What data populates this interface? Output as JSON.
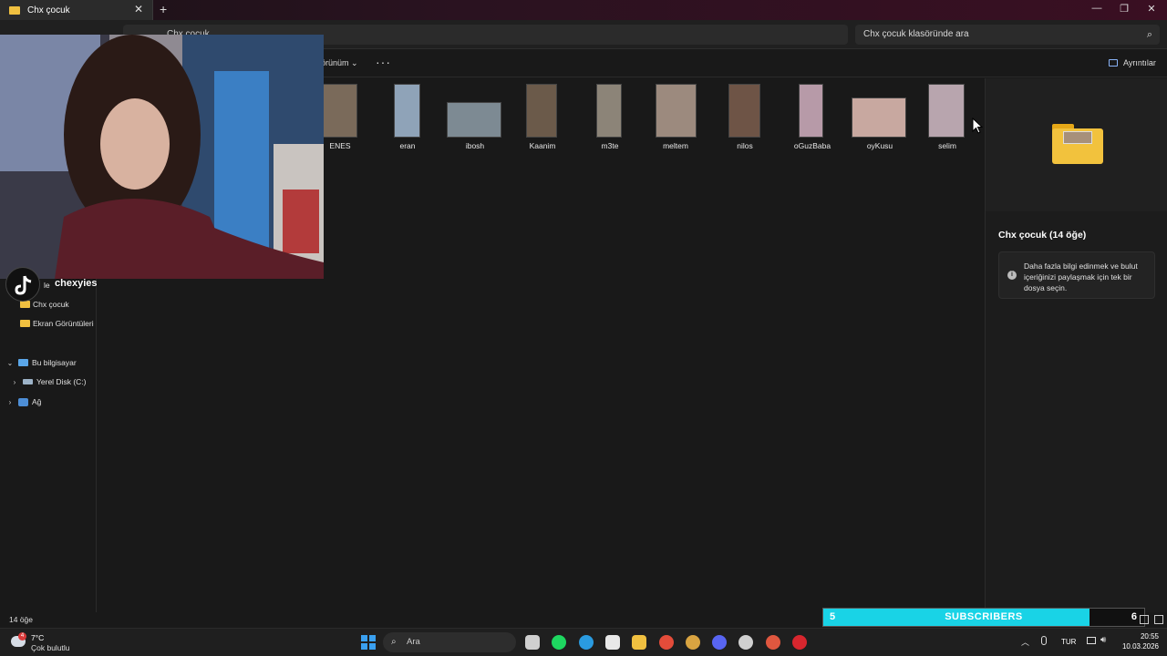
{
  "window": {
    "tab_title": "Chx çocuk",
    "tab_close": "✕",
    "new_tab": "+",
    "minimize": "—",
    "maximize": "❐",
    "close": "✕"
  },
  "addressbar": {
    "path": "Chx çocuk",
    "search_placeholder": "Chx çocuk klasöründe ara"
  },
  "commandbar": {
    "view_label": "örünüm",
    "more_label": "···",
    "details_label": "Ayrıntılar"
  },
  "nav": {
    "quick_partial": "le",
    "items": [
      {
        "label": "Chx çocuk",
        "icon": "folder-icon"
      },
      {
        "label": "Ekran Görüntüleri",
        "icon": "folder-icon"
      },
      {
        "label": "Bu bilgisayar",
        "icon": "pc-icon",
        "expanded": true
      },
      {
        "label": "Yerel Disk (C:)",
        "icon": "disk-icon",
        "expanded": false
      },
      {
        "label": "Ağ",
        "icon": "network-icon",
        "expanded": false
      }
    ]
  },
  "files": [
    {
      "name": "ENES",
      "thumb_color": "#7a6a5a"
    },
    {
      "name": "eran",
      "thumb_color": "#8fa3b8"
    },
    {
      "name": "ibosh",
      "thumb_color": "#7d8a93"
    },
    {
      "name": "Kaanim",
      "thumb_color": "#6b5a4a"
    },
    {
      "name": "m3te",
      "thumb_color": "#8c8478"
    },
    {
      "name": "meltem",
      "thumb_color": "#9c8a7e"
    },
    {
      "name": "nilos",
      "thumb_color": "#6e5446"
    },
    {
      "name": "oGuzBaba",
      "thumb_color": "#b79aa8"
    },
    {
      "name": "oyKusu",
      "thumb_color": "#c8a8a0"
    },
    {
      "name": "selim",
      "thumb_color": "#b8a5ae"
    }
  ],
  "details": {
    "folder_title": "Chx çocuk (14 öğe)",
    "info_text": "Daha fazla bilgi edinmek ve bulut içeriğinizi paylaşmak için tek bir dosya seçin.",
    "info_icon": "i"
  },
  "status": {
    "item_count": "14 öğe"
  },
  "overlay": {
    "tiktok_handle": "chexyies",
    "subscribers": {
      "current": "5",
      "label": "SUBSCRIBERS",
      "goal": "6",
      "progress": 0.83
    }
  },
  "taskbar": {
    "weather_temp": "7°C",
    "weather_condition": "Çok bulutlu",
    "weather_badge": "4",
    "search_placeholder": "Ara",
    "lang": "TUR",
    "time": "20:55",
    "date": "10.03.2026",
    "apps": [
      {
        "name": "task-view-icon",
        "color": "#cfcfcf"
      },
      {
        "name": "spotify-icon",
        "color": "#1ed760"
      },
      {
        "name": "edge-icon",
        "color": "#2a9be0"
      },
      {
        "name": "store-icon",
        "color": "#e8e8e8"
      },
      {
        "name": "file-explorer-icon",
        "color": "#f0c040"
      },
      {
        "name": "chrome-icon",
        "color": "#e44c3a"
      },
      {
        "name": "chrome-profile-icon",
        "color": "#d9a441"
      },
      {
        "name": "discord-icon",
        "color": "#5865f2"
      },
      {
        "name": "obs-icon",
        "color": "#d0d0d0"
      },
      {
        "name": "chrome-alt-icon",
        "color": "#e0573f"
      },
      {
        "name": "red-app-icon",
        "color": "#d8262e"
      }
    ]
  }
}
